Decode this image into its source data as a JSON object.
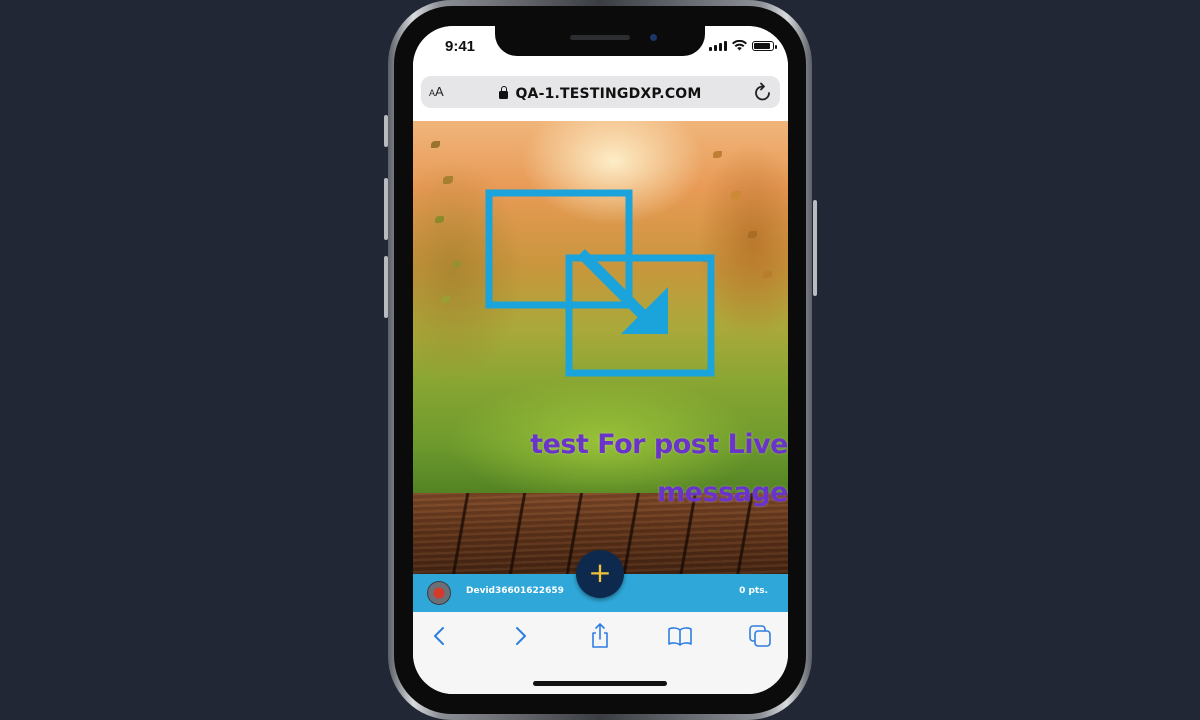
{
  "status_bar": {
    "time": "9:41"
  },
  "browser": {
    "text_size_button": {
      "small": "A",
      "large": "A"
    },
    "url": "QA-1.TESTINGDXP.COM",
    "icons": {
      "lock": "lock-icon",
      "reload": "reload-icon"
    }
  },
  "content": {
    "icon": "resize-arrow-icon",
    "icon_color": "#1ba3dc",
    "message_line1": "test For post Live",
    "message_line2": "message",
    "message_color": "#6a33c9"
  },
  "points_bar": {
    "username": "Devid36601622659",
    "points": "0 pts.",
    "bar_color": "#2fa8d9"
  },
  "fab": {
    "label": "+",
    "color": "#0d2a4e",
    "plus_color": "#f0c33a"
  },
  "toolbar": {
    "items": [
      "back-icon",
      "forward-icon",
      "share-icon",
      "bookmarks-icon",
      "tabs-icon"
    ],
    "tint": "#2f7fe0"
  }
}
